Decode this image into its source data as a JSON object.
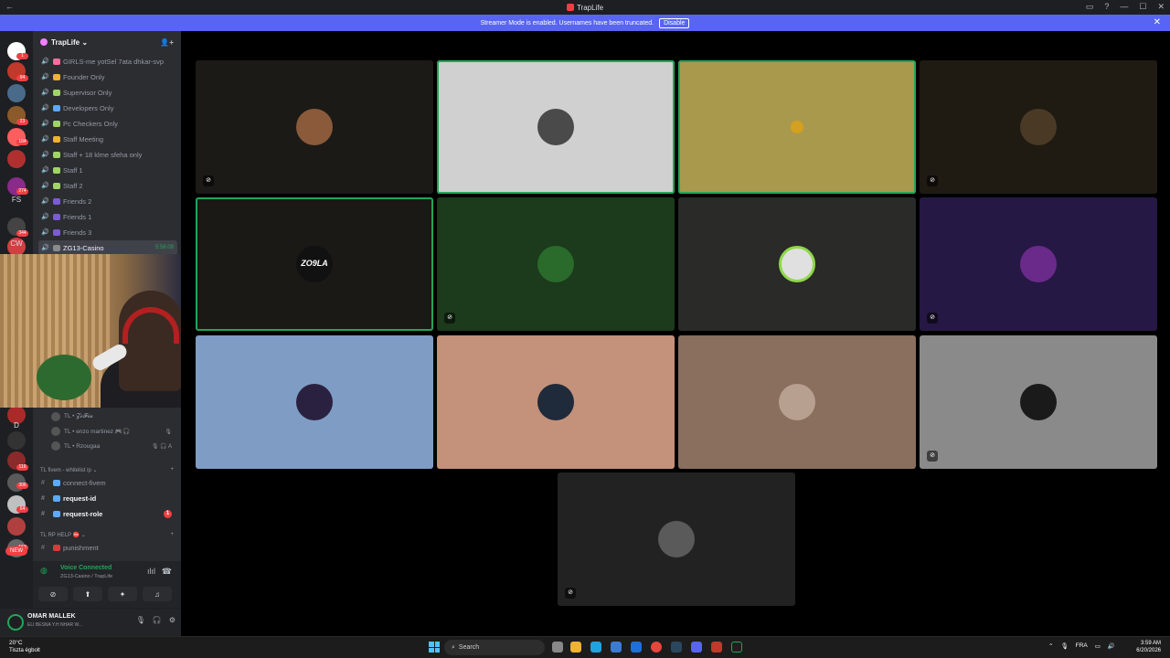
{
  "window": {
    "title": "TrapLife"
  },
  "banner": {
    "text": "Streamer Mode is enabled. Usernames have been truncated.",
    "button": "Disable"
  },
  "rail": {
    "badges": [
      "1",
      "94",
      "23",
      "184",
      "274",
      "344",
      "116",
      "306",
      "64",
      "163"
    ],
    "text_items": [
      "FS",
      "CW",
      "D"
    ],
    "new_labels": [
      "NEW",
      "NEW"
    ]
  },
  "server": {
    "name": "TrapLife ⌄"
  },
  "channels": [
    {
      "label": "GIRLS-me yotSel 7ata dhkar-svp",
      "emoji_color": "#ff6b9d"
    },
    {
      "label": "Founder Only",
      "emoji_color": "#f0b232"
    },
    {
      "label": "Supervisor Only",
      "emoji_color": "#a0d468"
    },
    {
      "label": "Developers Only",
      "emoji_color": "#5ea9ff"
    },
    {
      "label": "Pc Checkers Only",
      "emoji_color": "#a0d468"
    },
    {
      "label": "Staff Meeting",
      "emoji_color": "#f0b232"
    },
    {
      "label": "Staff + 18 klme sfeha only",
      "emoji_color": "#a0d468"
    },
    {
      "label": "Staff 1",
      "emoji_color": "#a0d468"
    },
    {
      "label": "Staff 2",
      "emoji_color": "#a0d468"
    },
    {
      "label": "Friends 2",
      "emoji_color": "#7b5cd6"
    },
    {
      "label": "Friends 1",
      "emoji_color": "#7b5cd6"
    },
    {
      "label": "Friends 3",
      "emoji_color": "#7b5cd6"
    }
  ],
  "active_channel": {
    "label": "ZG13-Casino",
    "time": "5:58:09"
  },
  "members": [
    {
      "name": "TL • 𝓩𝓸𝓕𝓲𝓪",
      "icons": ""
    },
    {
      "name": "TL • enzo martinez 🎮🎧",
      "icons": "🎙"
    },
    {
      "name": "TL • Rzougaa",
      "icons": "🎙 🎧 A"
    }
  ],
  "categories": [
    {
      "label": "TL fivem - whitelist ip ⌄"
    },
    {
      "label": "TL RP HELP ⛔ ⌄"
    }
  ],
  "text_channels": [
    {
      "label": "connect-fivem",
      "unread": false,
      "badge": ""
    },
    {
      "label": "request-id",
      "unread": true,
      "badge": ""
    },
    {
      "label": "request-role",
      "unread": true,
      "badge": "1"
    },
    {
      "label": "punishment",
      "unread": false,
      "badge": ""
    }
  ],
  "voice": {
    "status": "Voice Connected",
    "location": "ZG13-Casino / TrapLife"
  },
  "user": {
    "name": "OMAR MALLEK",
    "status": "ELI BESNA Y.H NHAR W..."
  },
  "tiles": [
    {
      "bg": "#1c1a16",
      "avatar": "#8a5a3a",
      "speaking": false,
      "muted": true
    },
    {
      "bg": "#d0d0d0",
      "avatar": "#4a4a4a",
      "speaking": true,
      "muted": false
    },
    {
      "bg": "#a9994d",
      "avatar": "#a9994d",
      "speaking": true,
      "muted": false
    },
    {
      "bg": "#1f1a12",
      "avatar": "#4a3a25",
      "speaking": false,
      "muted": true
    },
    {
      "bg": "#1a1916",
      "avatar": "#000000",
      "speaking": true,
      "muted": false
    },
    {
      "bg": "#1c3a1c",
      "avatar": "#2a6a2a",
      "speaking": false,
      "muted": true
    },
    {
      "bg": "#2a2a28",
      "avatar": "#e0e0e0",
      "speaking": false,
      "muted": false
    },
    {
      "bg": "#261844",
      "avatar": "#6a2a8a",
      "speaking": false,
      "muted": true
    },
    {
      "bg": "#7f9cc4",
      "avatar": "#2a2140",
      "speaking": false,
      "muted": false
    },
    {
      "bg": "#c4917a",
      "avatar": "#1f2a3a",
      "speaking": false,
      "muted": false
    },
    {
      "bg": "#8a6e5e",
      "avatar": "#b8a090",
      "speaking": false,
      "muted": false
    },
    {
      "bg": "#8a8a8a",
      "avatar": "#1a1a1a",
      "speaking": false,
      "muted": true
    },
    {
      "bg": "#222222",
      "avatar": "#5a5a5a",
      "speaking": false,
      "muted": true
    }
  ],
  "tile_text": {
    "zogla": "ZO9LA"
  },
  "taskbar": {
    "weather_temp": "20°C",
    "weather_desc": "Tiszta égbolt",
    "search": "Search",
    "lang": "FRA",
    "time": "3:59 AM",
    "date": "6/20/2026"
  }
}
